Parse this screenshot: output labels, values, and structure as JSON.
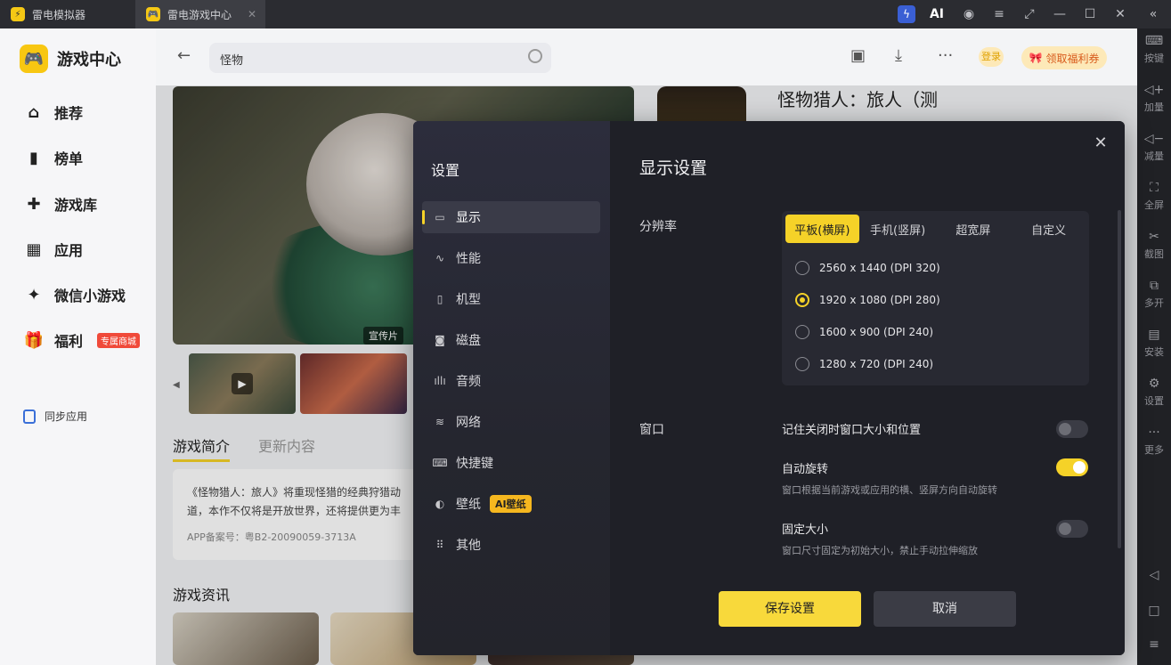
{
  "titlebar": {
    "tabs": [
      {
        "label": "雷电模拟器"
      },
      {
        "label": "雷电游戏中心"
      }
    ],
    "ai_label": "AI"
  },
  "rightbar": {
    "items": [
      {
        "label": "按键",
        "icon": "keyboard-icon"
      },
      {
        "label": "加量",
        "icon": "volume-up-icon"
      },
      {
        "label": "减量",
        "icon": "volume-down-icon"
      },
      {
        "label": "全屏",
        "icon": "fullscreen-icon"
      },
      {
        "label": "截图",
        "icon": "scissors-icon"
      },
      {
        "label": "多开",
        "icon": "multi-open-icon"
      },
      {
        "label": "安装",
        "icon": "install-icon"
      },
      {
        "label": "设置",
        "icon": "gear-icon"
      },
      {
        "label": "更多",
        "icon": "more-icon"
      }
    ]
  },
  "sidebar": {
    "brand": "游戏中心",
    "items": [
      {
        "label": "推荐",
        "icon": "home-icon"
      },
      {
        "label": "榜单",
        "icon": "chart-icon"
      },
      {
        "label": "游戏库",
        "icon": "gamepad-icon"
      },
      {
        "label": "应用",
        "icon": "apps-icon"
      },
      {
        "label": "微信小游戏",
        "icon": "sparkle-icon"
      },
      {
        "label": "福利",
        "icon": "gift-icon",
        "badge": "专属商城"
      }
    ],
    "sync_label": "同步应用"
  },
  "header": {
    "search_value": "怪物",
    "login_label": "登录",
    "welfare_label": "领取福利券"
  },
  "content": {
    "hero_tag": "宣传片",
    "intro_tabs": [
      "游戏简介",
      "更新内容"
    ],
    "intro_text_1": "《怪物猎人：旅人》将重现怪猎的经典狩猎动",
    "intro_text_2": "道，本作不仅将是开放世界，还将提供更为丰",
    "filing": "APP备案号：粤B2-20090059-3713A",
    "news_title": "游戏资讯",
    "game_title": "怪物猎人：旅人（测"
  },
  "dialog": {
    "side_title": "设置",
    "menu": [
      {
        "label": "显示",
        "icon": "monitor-icon"
      },
      {
        "label": "性能",
        "icon": "performance-icon"
      },
      {
        "label": "机型",
        "icon": "phone-icon"
      },
      {
        "label": "磁盘",
        "icon": "disk-icon"
      },
      {
        "label": "音频",
        "icon": "audio-icon"
      },
      {
        "label": "网络",
        "icon": "wifi-icon"
      },
      {
        "label": "快捷键",
        "icon": "keyboard-icon"
      },
      {
        "label": "壁纸",
        "icon": "palette-icon",
        "badge": "AI壁纸"
      },
      {
        "label": "其他",
        "icon": "grid-icon"
      }
    ],
    "active_menu": "显示",
    "title": "显示设置",
    "resolution_label": "分辨率",
    "resolution_tabs": [
      "平板(横屏)",
      "手机(竖屏)",
      "超宽屏",
      "自定义"
    ],
    "active_resolution_tab": "平板(横屏)",
    "resolutions": [
      {
        "label": "2560 x 1440  (DPI 320)",
        "selected": false
      },
      {
        "label": "1920 x 1080  (DPI 280)",
        "selected": true
      },
      {
        "label": "1600 x 900  (DPI 240)",
        "selected": false
      },
      {
        "label": "1280 x 720  (DPI 240)",
        "selected": false
      }
    ],
    "window_label": "窗口",
    "options": [
      {
        "title": "记住关闭时窗口大小和位置",
        "desc": "",
        "enabled": false
      },
      {
        "title": "自动旋转",
        "desc": "窗口根据当前游戏或应用的横、竖屏方向自动旋转",
        "enabled": true
      },
      {
        "title": "固定大小",
        "desc": "窗口尺寸固定为初始大小，禁止手动拉伸缩放",
        "enabled": false
      }
    ],
    "save_label": "保存设置",
    "cancel_label": "取消"
  },
  "colors": {
    "accent": "#f5d228",
    "dialog_bg": "#1f2027",
    "titlebar_bg": "#2b2c31"
  }
}
